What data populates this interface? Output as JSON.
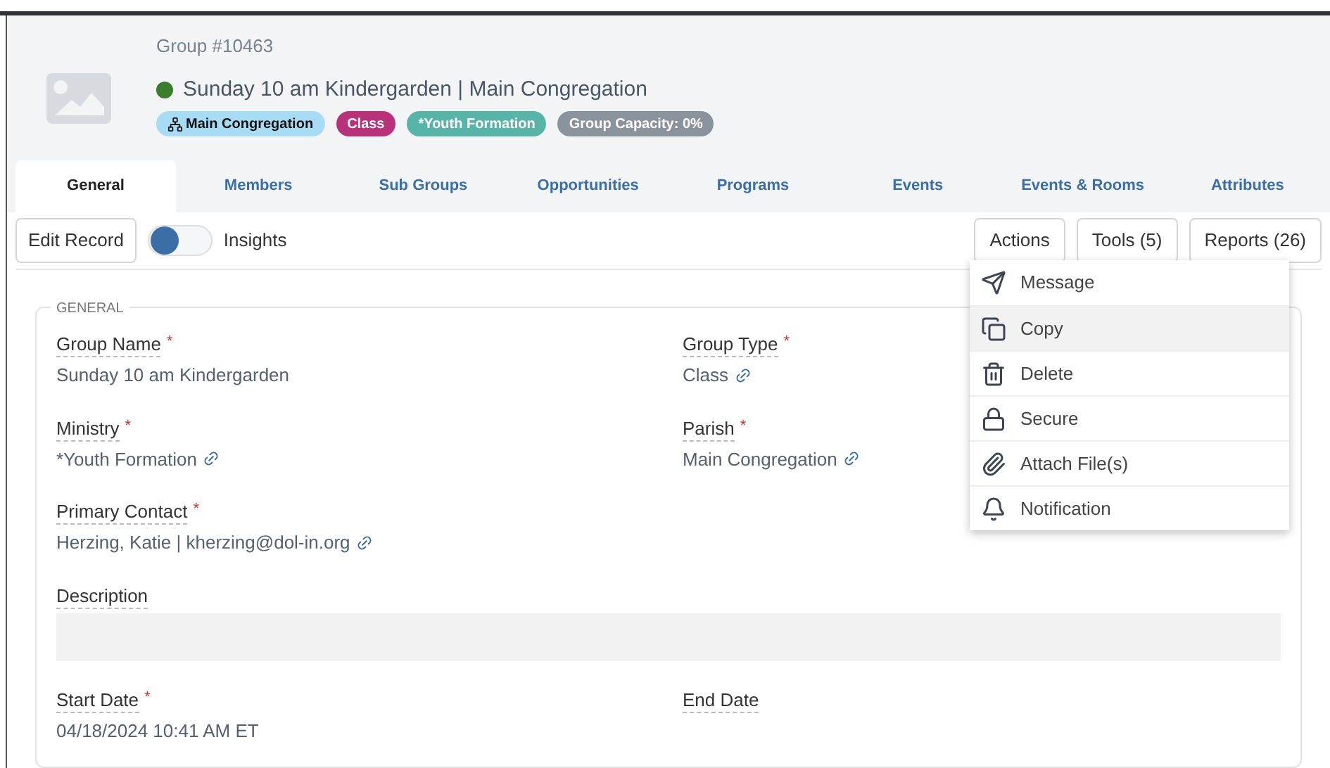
{
  "header": {
    "record_number": "Group #10463",
    "active": true,
    "title": "Sunday 10 am Kindergarden | Main Congregation",
    "badges": [
      {
        "label": "Main Congregation",
        "kind": "location",
        "color": "#a8dcf5"
      },
      {
        "label": "Class",
        "kind": "plain",
        "color": "#b8327a"
      },
      {
        "label": "*Youth Formation",
        "kind": "plain",
        "color": "#58b3a8"
      },
      {
        "label": "Group Capacity: 0%",
        "kind": "plain",
        "color": "#8a939c"
      }
    ]
  },
  "tabs": [
    {
      "label": "General",
      "selected": true
    },
    {
      "label": "Members",
      "selected": false
    },
    {
      "label": "Sub Groups",
      "selected": false
    },
    {
      "label": "Opportunities",
      "selected": false
    },
    {
      "label": "Programs",
      "selected": false
    },
    {
      "label": "Events",
      "selected": false
    },
    {
      "label": "Events & Rooms",
      "selected": false
    },
    {
      "label": "Attributes",
      "selected": false
    }
  ],
  "toolbar": {
    "edit_button": "Edit Record",
    "insights_toggle": {
      "label": "Insights",
      "on": false
    },
    "buttons": [
      "Actions",
      "Tools (5)",
      "Reports (26)"
    ]
  },
  "actions_menu": [
    {
      "label": "Message",
      "selected": false
    },
    {
      "label": "Copy",
      "selected": true
    },
    {
      "label": "Delete",
      "selected": false
    },
    {
      "label": "Secure",
      "selected": false
    },
    {
      "label": "Attach File(s)",
      "selected": false
    },
    {
      "label": "Notification",
      "selected": false
    }
  ],
  "section": {
    "legend": "GENERAL",
    "rows": [
      {
        "fields": [
          {
            "label": "Group Name",
            "required_mark": "*",
            "value": "Sunday 10 am Kindergarden",
            "kind": "text"
          },
          {
            "label": "Group Type",
            "required_mark": "*",
            "value": "Class",
            "link": true,
            "kind": "text"
          }
        ]
      },
      {
        "fields": [
          {
            "label": "Ministry",
            "required_mark": "*",
            "value": "*Youth Formation",
            "link": true,
            "kind": "text"
          },
          {
            "label": "Parish",
            "required_mark": "*",
            "value": "Main Congregation",
            "link": true,
            "kind": "text"
          }
        ]
      },
      {
        "fields": [
          {
            "label": "Primary Contact",
            "required_mark": "*",
            "value": "Herzing, Katie | kherzing@dol-in.org",
            "link": true,
            "kind": "text"
          }
        ]
      },
      {
        "fields": [
          {
            "label": "Description",
            "kind": "textarea"
          }
        ]
      },
      {
        "fields": [
          {
            "label": "Start Date",
            "required_mark": "*",
            "value": "04/18/2024 10:41 AM ET",
            "kind": "text"
          },
          {
            "label": "End Date",
            "kind": "text"
          }
        ]
      }
    ]
  }
}
